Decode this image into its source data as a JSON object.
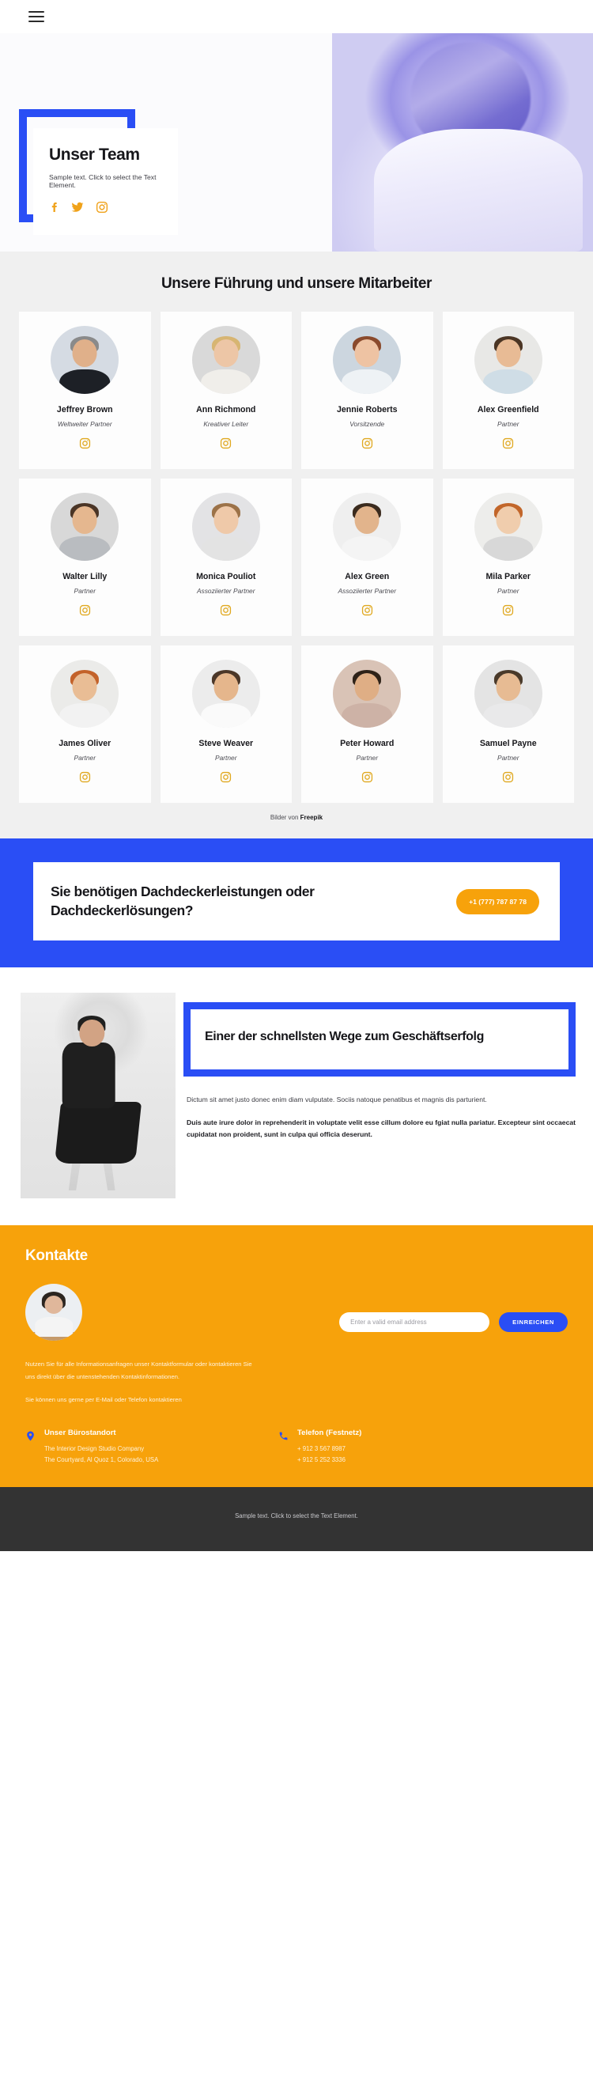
{
  "nav": {
    "menu_icon": "hamburger-menu-icon"
  },
  "hero": {
    "title": "Unser Team",
    "subtitle": "Sample text. Click to select the Text Element.",
    "socials": [
      {
        "name": "facebook-icon",
        "label": "Facebook"
      },
      {
        "name": "twitter-icon",
        "label": "Twitter"
      },
      {
        "name": "instagram-icon",
        "label": "Instagram"
      }
    ]
  },
  "team": {
    "heading": "Unsere Führung und unsere Mitarbeiter",
    "credit_prefix": "Bilder von ",
    "credit_link": "Freepik",
    "members": [
      {
        "name": "Jeffrey Brown",
        "role": "Weltweiter Partner",
        "skin": "#e0b08a",
        "hair": "#8a8a8a",
        "body": "#1d2026",
        "bg": "#d5dbe3"
      },
      {
        "name": "Ann Richmond",
        "role": "Kreativer Leiter",
        "skin": "#edc6a6",
        "hair": "#d7b572",
        "body": "#f0eeea",
        "bg": "#d9d9d9"
      },
      {
        "name": "Jennie Roberts",
        "role": "Vorsitzende",
        "skin": "#eec3a3",
        "hair": "#8a4a2c",
        "body": "#eef2f5",
        "bg": "#ccd6df"
      },
      {
        "name": "Alex Greenfield",
        "role": "Partner",
        "skin": "#e8bb95",
        "hair": "#4b3524",
        "body": "#cfdde6",
        "bg": "#e8e8e6"
      },
      {
        "name": "Walter Lilly",
        "role": "Partner",
        "skin": "#e5b78f",
        "hair": "#4a3526",
        "body": "#b9bcc0",
        "bg": "#d8d8d8"
      },
      {
        "name": "Monica Pouliot",
        "role": "Assoziierter Partner",
        "skin": "#efc9a9",
        "hair": "#9c7248",
        "body": "#e3e3e3",
        "bg": "#e3e3e5"
      },
      {
        "name": "Alex Green",
        "role": "Assoziierter Partner",
        "skin": "#e2b48c",
        "hair": "#3b2b1e",
        "body": "#f4f4f4",
        "bg": "#efefef"
      },
      {
        "name": "Mila Parker",
        "role": "Partner",
        "skin": "#f0cdad",
        "hair": "#c2662a",
        "body": "#d8d8d8",
        "bg": "#ededeb"
      },
      {
        "name": "James Oliver",
        "role": "Partner",
        "skin": "#e9bd95",
        "hair": "#c3622a",
        "body": "#f2f2f2",
        "bg": "#ebebe9"
      },
      {
        "name": "Steve Weaver",
        "role": "Partner",
        "skin": "#e5b68c",
        "hair": "#4b3728",
        "body": "#fafafa",
        "bg": "#ececec"
      },
      {
        "name": "Peter Howard",
        "role": "Partner",
        "skin": "#dfae85",
        "hair": "#2e2218",
        "body": "#cdb2a6",
        "bg": "#d9c3b6"
      },
      {
        "name": "Samuel Payne",
        "role": "Partner",
        "skin": "#e7bb93",
        "hair": "#4a3a2a",
        "body": "#e9e9ea",
        "bg": "#e4e4e4"
      }
    ]
  },
  "cta": {
    "title": "Sie benötigen Dachdeckerleistungen oder Dachdeckerlösungen?",
    "phone_button": "+1 (777) 787 87 78"
  },
  "split": {
    "title": "Einer der schnellsten Wege zum Geschäftserfolg",
    "paragraph": "Dictum sit amet justo donec enim diam vulputate. Sociis natoque penatibus et magnis dis parturient.",
    "paragraph_bold": "Duis aute irure dolor in reprehenderit in voluptate velit esse cillum dolore eu fgiat nulla pariatur. Excepteur sint occaecat cupidatat non proident, sunt in culpa qui officia deserunt."
  },
  "contact": {
    "heading": "Kontakte",
    "paragraph1": "Nutzen Sie für alle Informationsanfragen unser Kontaktformular oder kontaktieren Sie uns direkt über die untenstehenden Kontaktinformationen.",
    "paragraph2": "Sie können uns gerne per E-Mail oder Telefon kontaktieren",
    "email_placeholder": "Enter a valid email address",
    "email_value": "",
    "submit_label": "EINREICHEN",
    "office": {
      "title": "Unser Bürostandort",
      "line1": "The Interior Design Studio Company",
      "line2": "The Courtyard, Al Quoz 1, Colorado, USA"
    },
    "phone": {
      "title": "Telefon (Festnetz)",
      "line1": "+ 912 3 567 8987",
      "line2": "+ 912 5 252 3336"
    }
  },
  "footer": {
    "text": "Sample text. Click to select the Text Element."
  },
  "colors": {
    "blue": "#2a4ef5",
    "orange": "#f7a20b",
    "instagram_yellow": "#e0a81f",
    "dark": "#333333",
    "section_gray": "#f0f0f0"
  }
}
